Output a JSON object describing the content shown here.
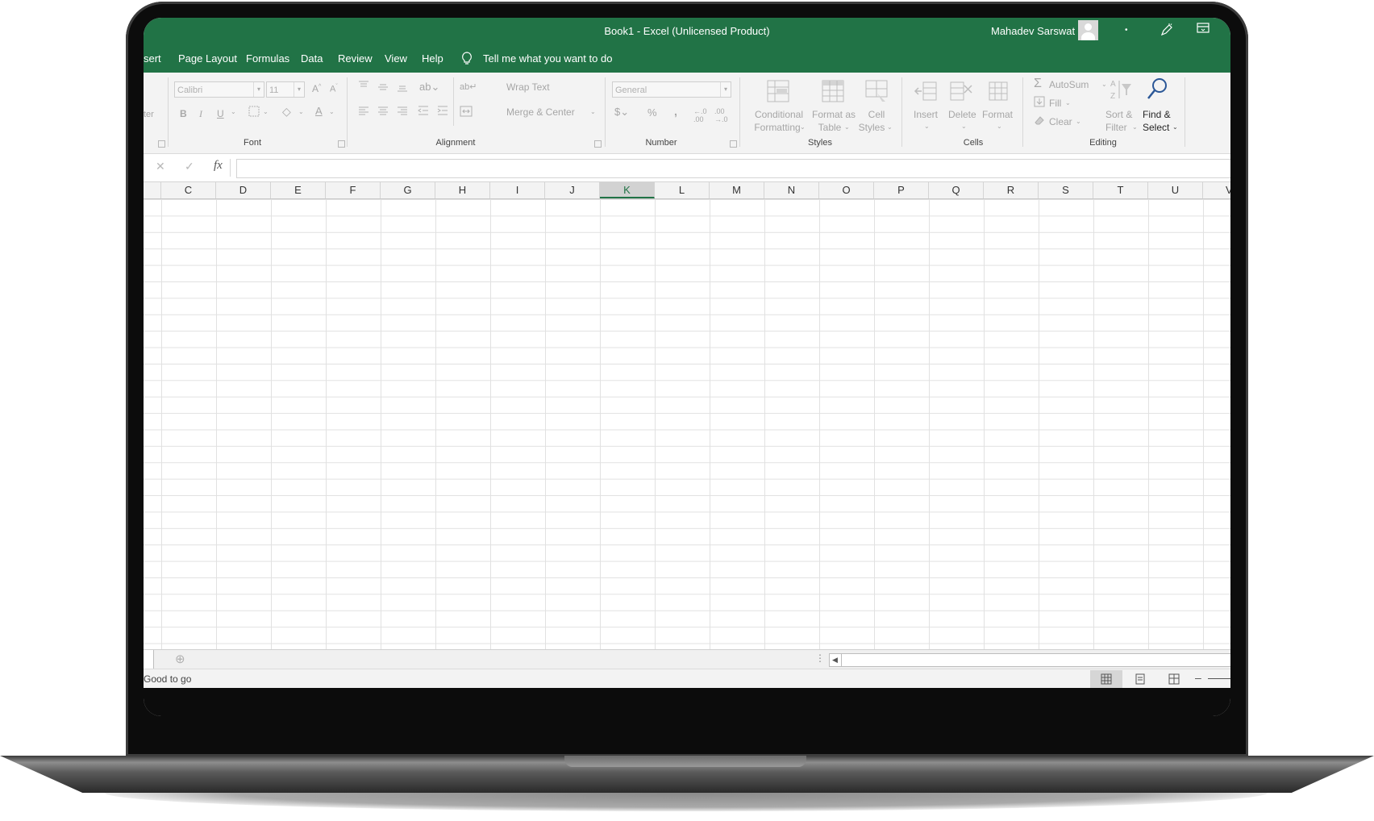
{
  "window": {
    "title": "Book1  -  Excel (Unlicensed Product)",
    "user_name": "Mahadev Sarswat"
  },
  "menu": {
    "tabs": [
      "sert",
      "Page Layout",
      "Formulas",
      "Data",
      "Review",
      "View",
      "Help"
    ],
    "tell_me": "Tell me what you want to do"
  },
  "ribbon": {
    "clipboard_partial": "ter",
    "font": {
      "family": "Calibri",
      "size": "11",
      "bold": "B",
      "italic": "I",
      "underline": "U",
      "label": "Font"
    },
    "alignment": {
      "wrap_text": "Wrap Text",
      "merge_center": "Merge & Center",
      "label": "Alignment"
    },
    "number": {
      "format": "General",
      "percent": "%",
      "comma": ",",
      "label": "Number"
    },
    "styles": {
      "conditional_1": "Conditional",
      "conditional_2": "Formatting",
      "format_table_1": "Format as",
      "format_table_2": "Table",
      "cell_styles_1": "Cell",
      "cell_styles_2": "Styles",
      "label": "Styles"
    },
    "cells": {
      "insert": "Insert",
      "delete": "Delete",
      "format": "Format",
      "label": "Cells"
    },
    "editing": {
      "autosum": "AutoSum",
      "fill": "Fill",
      "clear": "Clear",
      "sort_1": "Sort &",
      "sort_2": "Filter",
      "find_1": "Find &",
      "find_2": "Select",
      "label": "Editing"
    }
  },
  "formula_bar": {
    "fx": "fx"
  },
  "columns": [
    "C",
    "D",
    "E",
    "F",
    "G",
    "H",
    "I",
    "J",
    "K",
    "L",
    "M",
    "N",
    "O",
    "P",
    "Q",
    "R",
    "S",
    "T",
    "U",
    "V"
  ],
  "selected_column": "K",
  "status": {
    "text": "Good to go"
  },
  "colors": {
    "excel_green": "#217346",
    "ribbon_bg": "#f3f3f3"
  }
}
